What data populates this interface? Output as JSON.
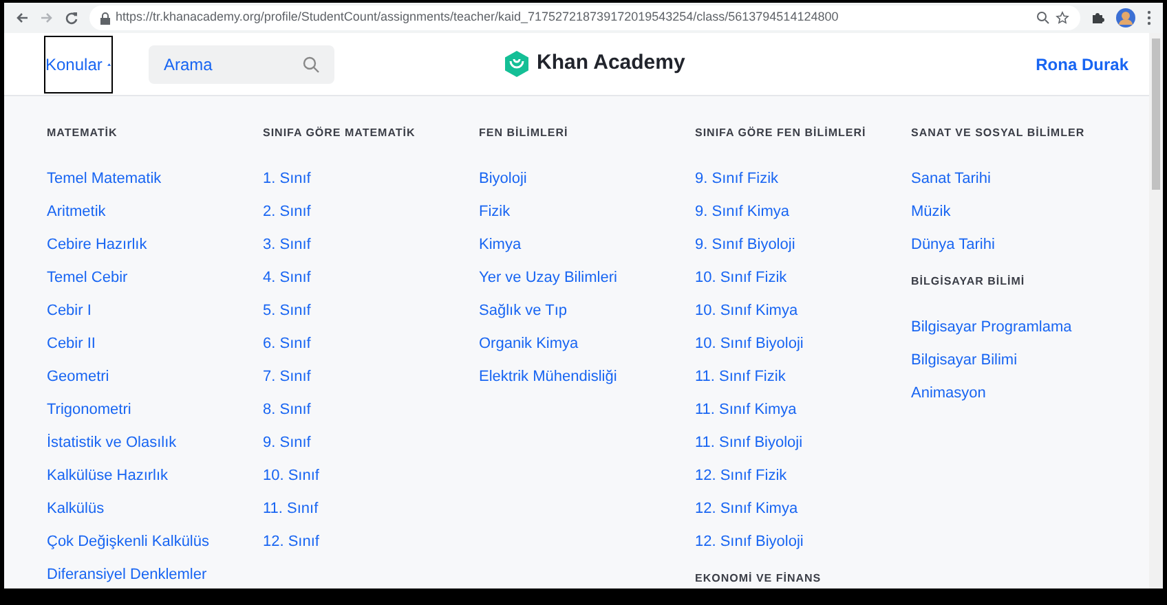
{
  "browser": {
    "url": "https://tr.khanacademy.org/profile/StudentCount/assignments/teacher/kaid_717527218739172019543254/class/5613794514124800"
  },
  "header": {
    "topics_button": {
      "label": "Konular",
      "expanded": true
    },
    "search": {
      "placeholder": "Arama"
    },
    "logo": "Khan Academy",
    "user": "Rona Durak"
  },
  "menu_columns": [
    {
      "sections": [
        {
          "heading": "MATEMATİK",
          "items": [
            "Temel Matematik",
            "Aritmetik",
            "Cebire Hazırlık",
            "Temel Cebir",
            "Cebir I",
            "Cebir II",
            "Geometri",
            "Trigonometri",
            "İstatistik ve Olasılık",
            "Kalkülüse Hazırlık",
            "Kalkülüs",
            "Çok Değişkenli Kalkülüs",
            "Diferansiyel Denklemler"
          ]
        }
      ]
    },
    {
      "sections": [
        {
          "heading": "SINIFA GÖRE MATEMATİK",
          "items": [
            "1. Sınıf",
            "2. Sınıf",
            "3. Sınıf",
            "4. Sınıf",
            "5. Sınıf",
            "6. Sınıf",
            "7. Sınıf",
            "8. Sınıf",
            "9. Sınıf",
            "10. Sınıf",
            "11. Sınıf",
            "12. Sınıf"
          ]
        }
      ]
    },
    {
      "sections": [
        {
          "heading": "FEN BİLİMLERİ",
          "items": [
            "Biyoloji",
            "Fizik",
            "Kimya",
            "Yer ve Uzay Bilimleri",
            "Sağlık ve Tıp",
            "Organik Kimya",
            "Elektrik Mühendisliği"
          ]
        }
      ]
    },
    {
      "sections": [
        {
          "heading": "SINIFA GÖRE FEN BİLİMLERİ",
          "items": [
            "9. Sınıf Fizik",
            "9. Sınıf Kimya",
            "9. Sınıf Biyoloji",
            "10. Sınıf Fizik",
            "10. Sınıf Kimya",
            "10. Sınıf Biyoloji",
            "11. Sınıf Fizik",
            "11. Sınıf Kimya",
            "11. Sınıf Biyoloji",
            "12. Sınıf Fizik",
            "12. Sınıf Kimya",
            "12. Sınıf Biyoloji"
          ]
        },
        {
          "heading": "EKONOMİ VE FİNANS"
        }
      ]
    },
    {
      "sections": [
        {
          "heading": "SANAT VE SOSYAL BİLİMLER",
          "items": [
            "Sanat Tarihi",
            "Müzik",
            "Dünya Tarihi"
          ]
        },
        {
          "heading": "BİLGİSAYAR BİLİMİ",
          "items": [
            "Bilgisayar Programlama",
            "Bilgisayar Bilimi",
            "Animasyon"
          ]
        }
      ]
    }
  ]
}
